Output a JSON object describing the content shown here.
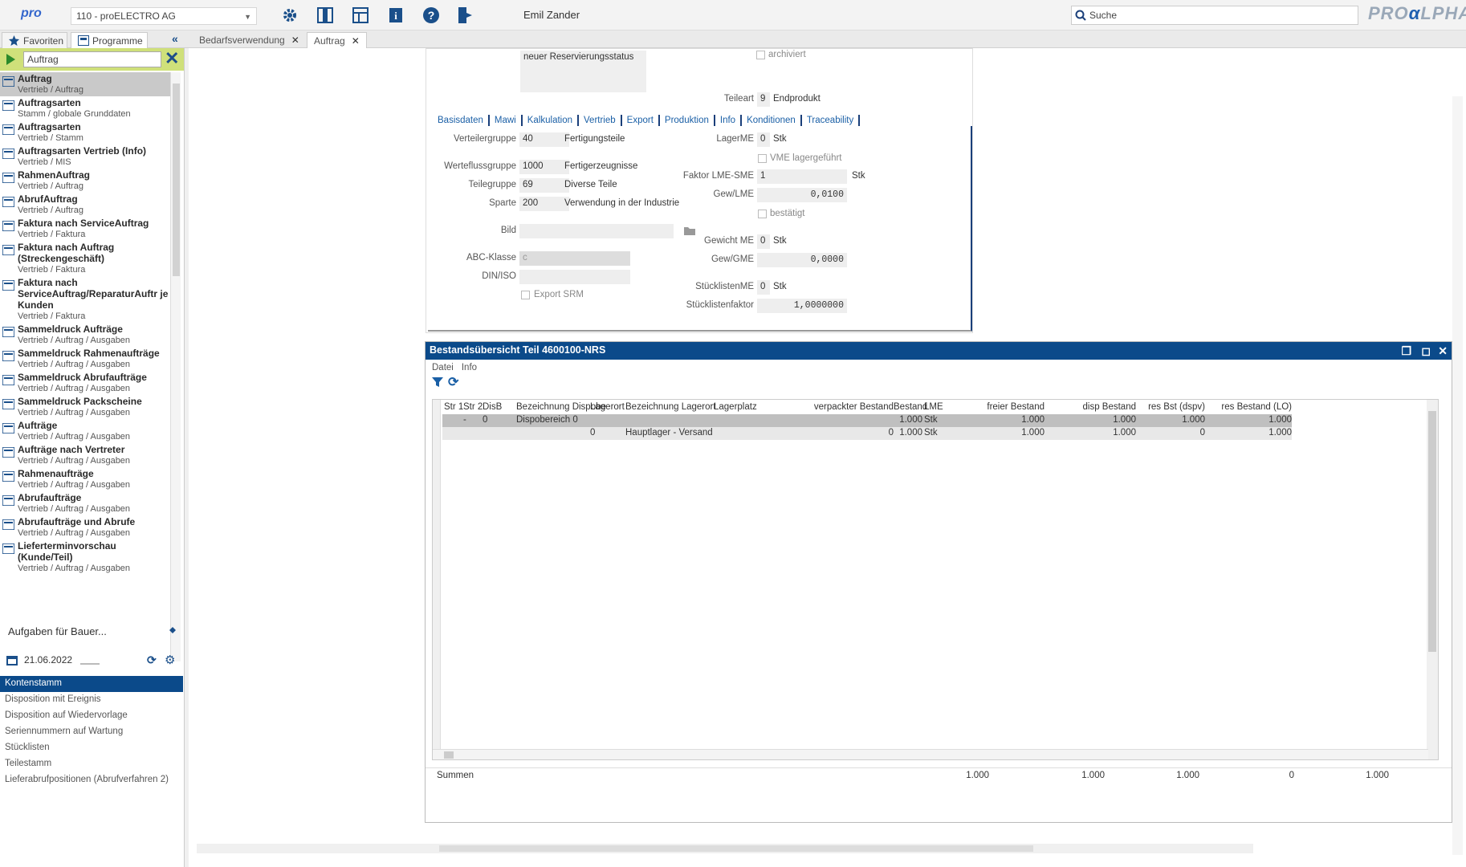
{
  "topbar": {
    "logo_text": "pro",
    "company": "110 - proELECTRO AG",
    "user": "Emil Zander",
    "search_placeholder": "Suche",
    "brand_left": "PRO",
    "brand_mid": "α",
    "brand_right": "LPHA"
  },
  "left_tabs": [
    "Favoriten",
    "Programme"
  ],
  "doc_tabs": [
    {
      "label": "Bedarfsverwendung",
      "active": false
    },
    {
      "label": "Auftrag",
      "active": true
    }
  ],
  "sidebar": {
    "search_value": "Auftrag",
    "items": [
      {
        "title": "Auftrag",
        "sub": "Vertrieb / Auftrag",
        "selected": true
      },
      {
        "title": "Auftragsarten",
        "sub": "Stamm / globale Grunddaten"
      },
      {
        "title": "Auftragsarten",
        "sub": "Vertrieb / Stamm"
      },
      {
        "title": "Auftragsarten Vertrieb (Info)",
        "sub": "Vertrieb / MIS"
      },
      {
        "title": "RahmenAuftrag",
        "sub": "Vertrieb / Auftrag"
      },
      {
        "title": "AbrufAuftrag",
        "sub": "Vertrieb / Auftrag"
      },
      {
        "title": "Faktura nach ServiceAuftrag",
        "sub": "Vertrieb / Faktura"
      },
      {
        "title": "Faktura nach Auftrag (Streckengeschäft)",
        "sub": "Vertrieb / Faktura"
      },
      {
        "title": "Faktura nach ServiceAuftrag/ReparaturAuftr je Kunden",
        "sub": "Vertrieb / Faktura"
      },
      {
        "title": "Sammeldruck Aufträge",
        "sub": "Vertrieb / Auftrag / Ausgaben"
      },
      {
        "title": "Sammeldruck Rahmenaufträge",
        "sub": "Vertrieb / Auftrag / Ausgaben"
      },
      {
        "title": "Sammeldruck Abrufaufträge",
        "sub": "Vertrieb / Auftrag / Ausgaben"
      },
      {
        "title": "Sammeldruck Packscheine",
        "sub": "Vertrieb / Auftrag / Ausgaben"
      },
      {
        "title": "Aufträge",
        "sub": "Vertrieb / Auftrag / Ausgaben"
      },
      {
        "title": "Aufträge nach Vertreter",
        "sub": "Vertrieb / Auftrag / Ausgaben"
      },
      {
        "title": "Rahmenaufträge",
        "sub": "Vertrieb / Auftrag / Ausgaben"
      },
      {
        "title": "Abrufaufträge",
        "sub": "Vertrieb / Auftrag / Ausgaben"
      },
      {
        "title": "Abrufaufträge und Abrufe",
        "sub": "Vertrieb / Auftrag / Ausgaben"
      },
      {
        "title": "Lieferterminvorschau (Kunde/Teil)",
        "sub": "Vertrieb / Auftrag / Ausgaben"
      }
    ],
    "aufgaben_label": "Aufgaben für Bauer...",
    "date": "21.06.2022",
    "tasks": [
      {
        "label": "Kontenstamm",
        "selected": true
      },
      {
        "label": "Disposition mit Ereignis"
      },
      {
        "label": "Disposition auf Wiedervorlage"
      },
      {
        "label": "Seriennummern auf Wartung"
      },
      {
        "label": "Stücklisten"
      },
      {
        "label": "Teilestamm"
      },
      {
        "label": "Lieferabrufpositionen (Abrufverfahren 2)"
      }
    ]
  },
  "form": {
    "reservierung_text": "neuer Reservierungsstatus",
    "archiviert": "archiviert",
    "teileart_label": "Teileart",
    "teileart_value": "9",
    "teileart_text": "Endprodukt",
    "tabs": [
      "Basisdaten",
      "Mawi",
      "Kalkulation",
      "Vertrieb",
      "Export",
      "Produktion",
      "Info",
      "Konditionen",
      "Traceability"
    ],
    "verteilergruppe_label": "Verteilergruppe",
    "verteilergruppe_value": "40",
    "verteilergruppe_text": "Fertigungsteile",
    "werteflussgruppe_label": "Werteflussgruppe",
    "werteflussgruppe_value": "1000",
    "werteflussgruppe_text": "Fertigerzeugnisse",
    "teilegruppe_label": "Teilegruppe",
    "teilegruppe_value": "69",
    "teilegruppe_text": "Diverse Teile",
    "sparte_label": "Sparte",
    "sparte_value": "200",
    "sparte_text": "Verwendung in der Industrie",
    "bild_label": "Bild",
    "abc_label": "ABC-Klasse",
    "abc_value": "c",
    "din_label": "DIN/ISO",
    "export_srm": "Export SRM",
    "lagerme_label": "LagerME",
    "lagerme_value": "0",
    "lagerme_unit": "Stk",
    "vme_label": "VME lagergeführt",
    "faktor_label": "Faktor LME-SME",
    "faktor_value": "1",
    "faktor_unit": "Stk",
    "gewlme_label": "Gew/LME",
    "gewlme_value": "0,0100",
    "bestaetigt": "bestätigt",
    "gewichtme_label": "Gewicht ME",
    "gewichtme_value": "0",
    "gewichtme_unit": "Stk",
    "gewgme_label": "Gew/GME",
    "gewgme_value": "0,0000",
    "stuecklistenme_label": "StücklistenME",
    "stuecklistenme_value": "0",
    "stuecklistenme_unit": "Stk",
    "stuecklistenfaktor_label": "Stücklistenfaktor",
    "stuecklistenfaktor_value": "1,0000000"
  },
  "panel": {
    "title": "Bestandsübersicht Teil 4600100-NRS",
    "menu": [
      "Datei",
      "Info"
    ],
    "columns": [
      "Str 1",
      "Str 2",
      "DisB",
      "Bezeichnung Dispobe",
      "Lagerort",
      "Bezeichnung Lagerort",
      "Lagerplatz",
      "verpackter Bestand",
      "Bestand",
      "LME",
      "freier Bestand",
      "disp Bestand",
      "res Bst (dspv)",
      "res Bestand (LO)"
    ],
    "rows": [
      {
        "str1": "",
        "str2": "-",
        "disb": "0",
        "bez_dispo": "Dispobereich 0",
        "lagerort": "",
        "bez_lagerort": "",
        "lagerplatz": "",
        "verpackt": "",
        "bestand": "1.000",
        "lme": "Stk",
        "frei": "1.000",
        "disp": "1.000",
        "res_dspv": "1.000",
        "res_lo": "1.000"
      },
      {
        "str1": "",
        "str2": "",
        "disb": "",
        "bez_dispo": "",
        "lagerort": "0",
        "bez_lagerort": "Hauptlager - Versand",
        "lagerplatz": "",
        "verpackt": "0",
        "bestand": "1.000",
        "lme": "Stk",
        "frei": "1.000",
        "disp": "1.000",
        "res_dspv": "0",
        "res_lo": "1.000"
      }
    ],
    "sums_label": "Summen",
    "sums": {
      "bestand": "1.000",
      "frei": "1.000",
      "disp": "1.000",
      "res_dspv": "0",
      "res_lo": "1.000"
    }
  }
}
